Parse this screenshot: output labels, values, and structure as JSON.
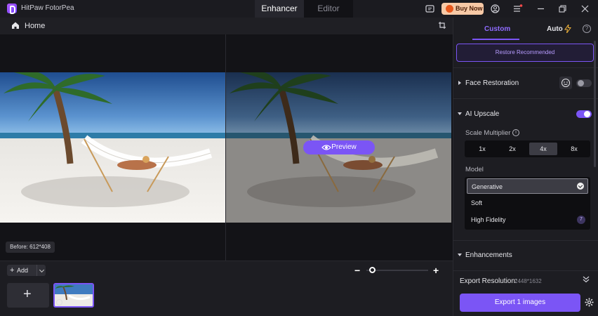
{
  "app": {
    "title": "HitPaw FotorPea"
  },
  "mode_tabs": [
    {
      "label": "Enhancer",
      "active": true
    },
    {
      "label": "Editor",
      "active": false
    }
  ],
  "titlebar": {
    "buy_label": "Buy Now"
  },
  "subbar": {
    "home_label": "Home"
  },
  "canvas": {
    "preview_label": "Preview",
    "before_size": "Before: 612*408"
  },
  "bottom": {
    "add_label": "Add",
    "zoom_level": 0.05
  },
  "panel": {
    "tabs": {
      "custom": "Custom",
      "auto": "Auto"
    },
    "restore_button": "Restore Recommended",
    "face_restoration": {
      "title": "Face Restoration",
      "enabled": false
    },
    "ai_upscale": {
      "title": "AI Upscale",
      "enabled": true,
      "scale_label": "Scale Multiplier",
      "scales": [
        "1x",
        "2x",
        "4x",
        "8x"
      ],
      "selected_scale": "4x",
      "model_label": "Model",
      "models": [
        {
          "name": "Generative",
          "selected": true
        },
        {
          "name": "Soft",
          "selected": false
        },
        {
          "name": "High Fidelity",
          "selected": false,
          "badge": "7"
        }
      ]
    },
    "enhancements": {
      "title": "Enhancements"
    },
    "export": {
      "resolution_label": "Export Resolution:",
      "resolution_value": "2448*1632",
      "button_label": "Export 1 images"
    }
  },
  "colors": {
    "accent": "#7b55f5",
    "buy_button": "#f7c9a6",
    "background": "#17171b"
  }
}
